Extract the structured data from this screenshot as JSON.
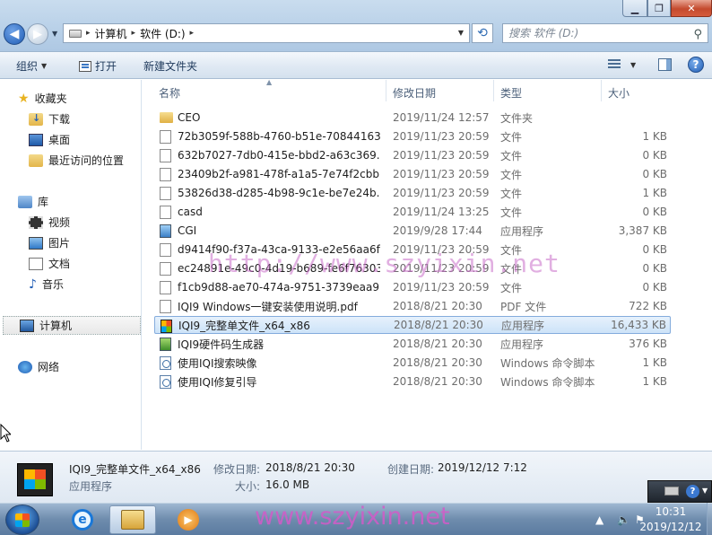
{
  "window": {
    "controls": {
      "minimize": "▁",
      "maximize": "❐",
      "close": "✕"
    }
  },
  "address": {
    "crumbs": [
      "计算机",
      "软件 (D:)"
    ],
    "separator": "▸",
    "search_placeholder": "搜索 软件 (D:)"
  },
  "toolbar": {
    "organize": "组织",
    "open": "打开",
    "new_folder": "新建文件夹"
  },
  "nav": {
    "favorites": "收藏夹",
    "downloads": "下载",
    "desktop": "桌面",
    "recent": "最近访问的位置",
    "libraries": "库",
    "videos": "视频",
    "pictures": "图片",
    "documents": "文档",
    "music": "音乐",
    "computer": "计算机",
    "network": "网络"
  },
  "columns": {
    "name": "名称",
    "date": "修改日期",
    "type": "类型",
    "size": "大小"
  },
  "files": [
    {
      "icon": "folder",
      "name": "CEO",
      "date": "2019/11/24 12:57",
      "type": "文件夹",
      "size": ""
    },
    {
      "icon": "blank",
      "name": "72b3059f-588b-4760-b51e-70844163...",
      "date": "2019/11/23 20:59",
      "type": "文件",
      "size": "1 KB"
    },
    {
      "icon": "blank",
      "name": "632b7027-7db0-415e-bbd2-a63c369...",
      "date": "2019/11/23 20:59",
      "type": "文件",
      "size": "0 KB"
    },
    {
      "icon": "blank",
      "name": "23409b2f-a981-478f-a1a5-7e74f2cbb...",
      "date": "2019/11/23 20:59",
      "type": "文件",
      "size": "0 KB"
    },
    {
      "icon": "blank",
      "name": "53826d38-d285-4b98-9c1e-be7e24b...",
      "date": "2019/11/23 20:59",
      "type": "文件",
      "size": "1 KB"
    },
    {
      "icon": "blank",
      "name": "casd",
      "date": "2019/11/24 13:25",
      "type": "文件",
      "size": "0 KB"
    },
    {
      "icon": "exe",
      "name": "CGI",
      "date": "2019/9/28 17:44",
      "type": "应用程序",
      "size": "3,387 KB"
    },
    {
      "icon": "blank",
      "name": "d9414f90-f37a-43ca-9133-e2e56aa6f...",
      "date": "2019/11/23 20:59",
      "type": "文件",
      "size": "0 KB"
    },
    {
      "icon": "blank",
      "name": "ec24891e-49c0-4d19-b689-fe6f76303...",
      "date": "2019/11/23 20:59",
      "type": "文件",
      "size": "0 KB"
    },
    {
      "icon": "blank",
      "name": "f1cb9d88-ae70-474a-9751-3739eaa9...",
      "date": "2019/11/23 20:59",
      "type": "文件",
      "size": "0 KB"
    },
    {
      "icon": "pdf",
      "name": "IQI9 Windows一键安装使用说明.pdf",
      "date": "2018/8/21 20:30",
      "type": "PDF 文件",
      "size": "722 KB"
    },
    {
      "icon": "winlogo",
      "name": "IQI9_完整单文件_x64_x86",
      "date": "2018/8/21 20:30",
      "type": "应用程序",
      "size": "16,433 KB",
      "selected": true
    },
    {
      "icon": "exe-green",
      "name": "IQI9硬件码生成器",
      "date": "2018/8/21 20:30",
      "type": "应用程序",
      "size": "376 KB"
    },
    {
      "icon": "cmd",
      "name": "使用IQI搜索映像",
      "date": "2018/8/21 20:30",
      "type": "Windows 命令脚本",
      "size": "1 KB"
    },
    {
      "icon": "cmd",
      "name": "使用IQI修复引导",
      "date": "2018/8/21 20:30",
      "type": "Windows 命令脚本",
      "size": "1 KB"
    }
  ],
  "details": {
    "name": "IQI9_完整单文件_x64_x86",
    "kind": "应用程序",
    "modified_label": "修改日期:",
    "modified": "2018/8/21 20:30",
    "created_label": "创建日期:",
    "created": "2019/12/12 7:12",
    "size_label": "大小:",
    "size": "16.0 MB"
  },
  "watermark": {
    "overlay": "http://www.szyixin.net",
    "footer": "www.szyixin.net"
  },
  "taskbar": {
    "time": "10:31",
    "date": "2019/12/12",
    "tray_help": "?",
    "ie_glyph": "e",
    "media_glyph": "▶"
  }
}
